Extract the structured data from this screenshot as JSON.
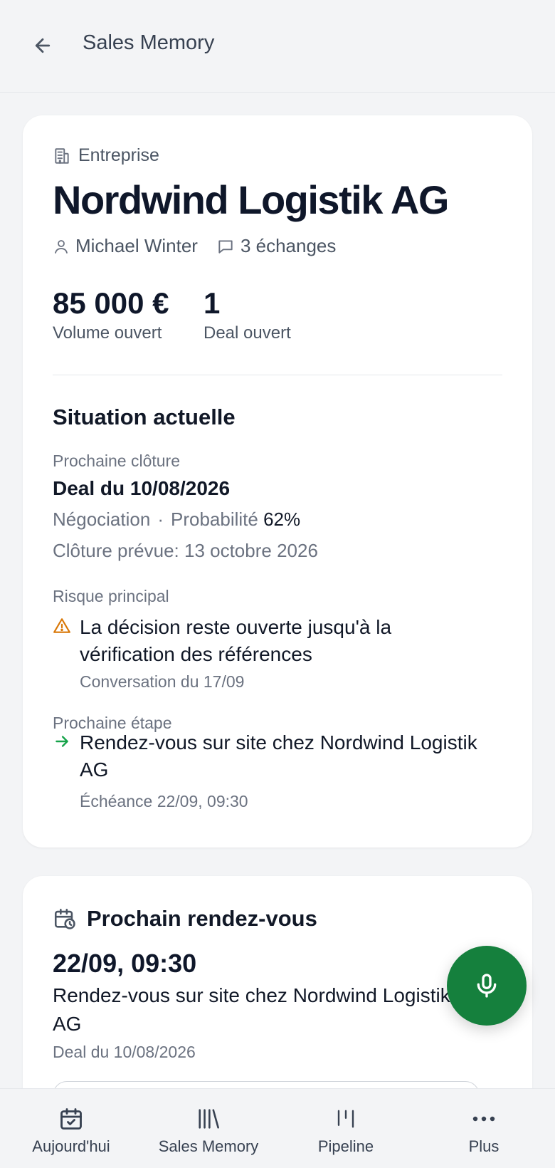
{
  "header": {
    "title": "Sales Memory"
  },
  "company": {
    "kind": "Entreprise",
    "name": "Nordwind Logistik AG",
    "contact": "Michael Winter",
    "exchanges": "3 échanges"
  },
  "stats": [
    {
      "value": "85 000 €",
      "label": "Volume ouvert"
    },
    {
      "value": "1",
      "label": "Deal ouvert"
    }
  ],
  "situation": {
    "title": "Situation actuelle",
    "next_close_label": "Prochaine clôture",
    "deal": "Deal du 10/08/2026",
    "stage": "Négociation",
    "probability_label": "Probabilité",
    "probability_value": "62%",
    "expected_close": "Clôture prévue: 13 octobre 2026",
    "risk_label": "Risque principal",
    "risk_text": "La décision reste ouverte jusqu'à la vérification des références",
    "risk_source": "Conversation du 17/09",
    "next_step_label": "Prochaine étape",
    "next_step_text": "Rendez-vous sur site chez Nordwind Logistik AG",
    "next_step_due": "Échéance 22/09, 09:30"
  },
  "next_meeting": {
    "title": "Prochain rendez-vous",
    "time": "22/09, 09:30",
    "description": "Rendez-vous sur site chez Nordwind Logistik AG",
    "deal": "Deal du 10/08/2026"
  },
  "nav": [
    {
      "label": "Aujourd'hui",
      "icon": "calendar-check-icon"
    },
    {
      "label": "Sales Memory",
      "icon": "library-icon"
    },
    {
      "label": "Pipeline",
      "icon": "pipeline-icon"
    },
    {
      "label": "Plus",
      "icon": "more-icon"
    }
  ],
  "colors": {
    "accent": "#15803d",
    "warning": "#d97706",
    "arrow": "#16a34a"
  }
}
